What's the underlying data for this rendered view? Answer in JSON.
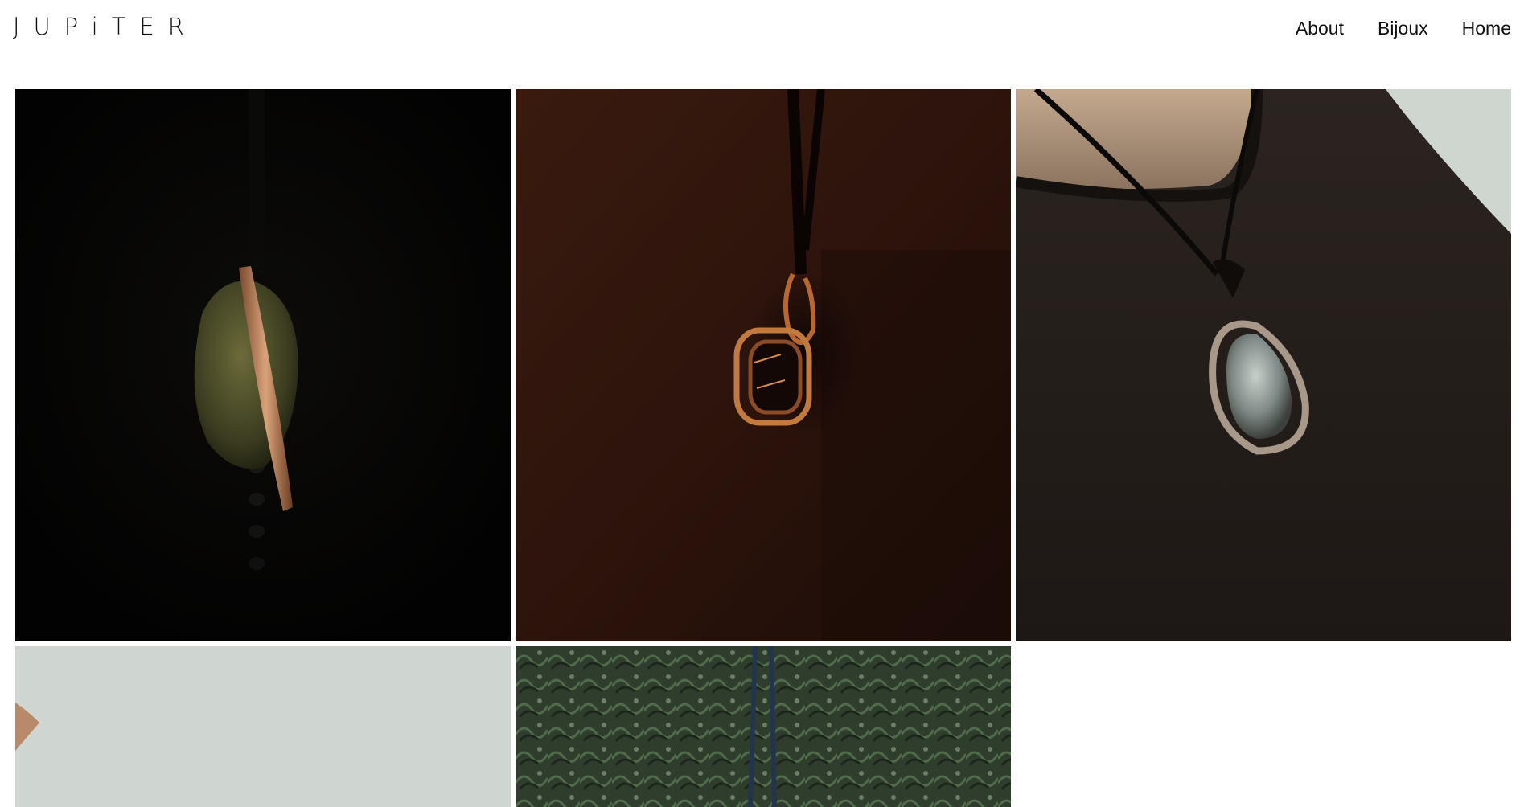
{
  "header": {
    "logo_text": "JUPiTER",
    "nav": [
      {
        "label": "About"
      },
      {
        "label": "Bijoux"
      },
      {
        "label": "Home"
      }
    ]
  },
  "colors": {
    "background": "#ffffff",
    "text": "#111111"
  },
  "gallery": {
    "tiles": [
      {
        "subject": "copper-bar-pendant-green-stone-dark"
      },
      {
        "subject": "copper-wire-loop-pendant-brown-fabric"
      },
      {
        "subject": "silver-wrapped-stone-pendant-black-sweater"
      },
      {
        "subject": "pendant-grey-background-partial"
      },
      {
        "subject": "pendant-green-foliage-partial"
      }
    ]
  }
}
